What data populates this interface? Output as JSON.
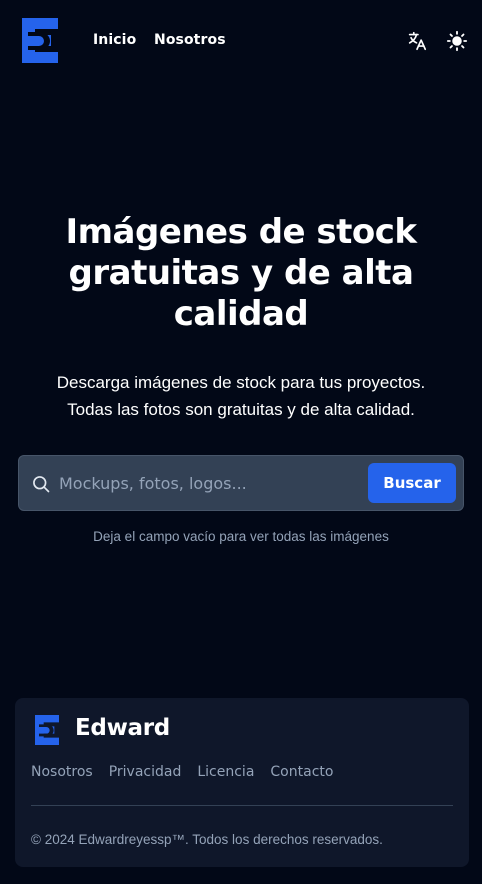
{
  "header": {
    "nav": [
      {
        "label": "Inicio"
      },
      {
        "label": "Nosotros"
      }
    ],
    "translate_icon": "translate-icon",
    "theme_icon": "sun-icon"
  },
  "hero": {
    "title_lines": [
      "Imágenes de stock",
      "gratuitas y de alta",
      "calidad"
    ],
    "subtitle_lines": [
      "Descarga imágenes de stock para tus proyectos.",
      "Todas las fotos son gratuitas y de alta calidad."
    ]
  },
  "search": {
    "placeholder": "Mockups, fotos, logos...",
    "value": "",
    "button_label": "Buscar",
    "hint": "Deja el campo vacío para ver todas las imágenes"
  },
  "footer": {
    "brand": "Edward",
    "links": [
      {
        "label": "Nosotros"
      },
      {
        "label": "Privacidad"
      },
      {
        "label": "Licencia"
      },
      {
        "label": "Contacto"
      }
    ],
    "copyright": "© 2024 Edwardreyessp™. Todos los derechos reservados."
  },
  "colors": {
    "background": "#020817",
    "accent": "#2563eb",
    "muted_text": "#94a3b8",
    "footer_bg": "#0f172a",
    "input_bg": "#334155"
  }
}
